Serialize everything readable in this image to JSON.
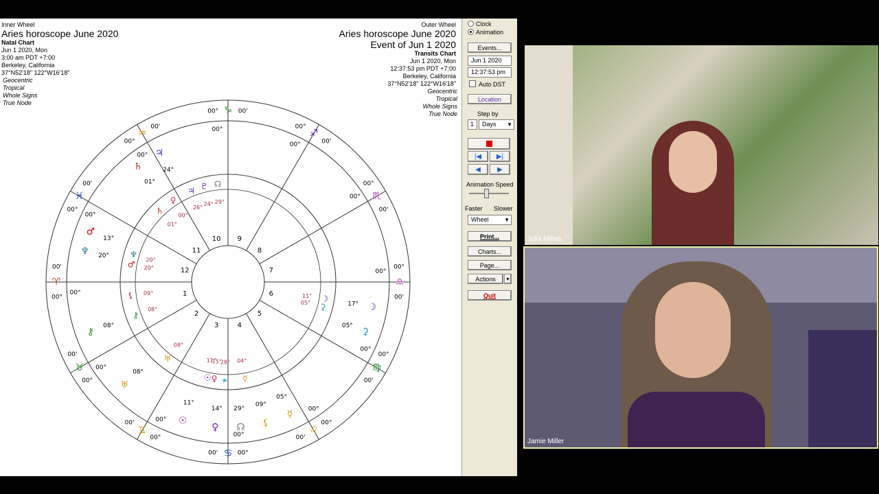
{
  "inner_header": {
    "label": "Inner Wheel",
    "title": "Aries horoscope June 2020",
    "chart_type": "Natal Chart",
    "date": "Jun 1 2020, Mon",
    "time": "3:00 am  PDT +7:00",
    "place": "Berkeley, California",
    "coords": "37°N52'18\" 122°W16'18\"",
    "options": [
      "Geocentric",
      "Tropical",
      "Whole Signs",
      "True Node"
    ]
  },
  "outer_header": {
    "label": "Outer Wheel",
    "title": "Aries horoscope June 2020",
    "event": "Event of Jun 1 2020",
    "chart_type": "Transits Chart",
    "date": "Jun 1 2020, Mon",
    "time": "12:37:53 pm  PDT +7:00",
    "place": "Berkeley, California",
    "coords": "37°N52'18\" 122°W16'18\"",
    "options": [
      "Geocentric",
      "Tropical",
      "Whole Signs",
      "True Node"
    ]
  },
  "wheel": {
    "house_numbers": [
      "1",
      "2",
      "3",
      "4",
      "5",
      "6",
      "7",
      "8",
      "9",
      "10",
      "11",
      "12"
    ],
    "cusp_degree": "00°",
    "cusp_minute": "00'",
    "signs": [
      "♈",
      "♉",
      "♊",
      "♋",
      "♌",
      "♍",
      "♎",
      "♏",
      "♐",
      "♑",
      "♒",
      "♓"
    ],
    "sign_colors": [
      "#c0392b",
      "#2e8b2e",
      "#d4a017",
      "#1f3fbf",
      "#d4a017",
      "#2e8b2e",
      "#b43ab4",
      "#b43ab4",
      "#6a2fb0",
      "#2e8b2e",
      "#d4a017",
      "#1f3fbf"
    ],
    "natal_labels": [
      {
        "glyph": "♃",
        "deg": "26°"
      },
      {
        "glyph": "♀",
        "deg": "00°"
      },
      {
        "glyph": "♄",
        "deg": "01°"
      },
      {
        "glyph": "♇",
        "deg": "24°"
      },
      {
        "glyph": "☊",
        "deg": "29°"
      },
      {
        "glyph": "♂",
        "deg": "20°"
      },
      {
        "glyph": "♆",
        "deg": "20°"
      },
      {
        "glyph": "⚷",
        "deg": "08°"
      },
      {
        "glyph": "♅",
        "deg": "08°"
      },
      {
        "glyph": "☉",
        "deg": "11°"
      },
      {
        "glyph": "♀",
        "deg": "15°"
      },
      {
        "glyph": "⚹",
        "deg": "28°"
      },
      {
        "glyph": "☿",
        "deg": "04°"
      },
      {
        "glyph": "☽",
        "deg": "11°"
      },
      {
        "glyph": "⚳",
        "deg": "05°"
      },
      {
        "glyph": "⚸",
        "deg": "09°"
      }
    ],
    "transit_labels": [
      {
        "glyph": "♃",
        "deg": "24°"
      },
      {
        "glyph": "♄",
        "deg": "01°"
      },
      {
        "glyph": "♂",
        "deg": "13°"
      },
      {
        "glyph": "♆",
        "deg": "20°"
      },
      {
        "glyph": "⚷",
        "deg": "08°"
      },
      {
        "glyph": "♅",
        "deg": "08°"
      },
      {
        "glyph": "☉",
        "deg": "11°"
      },
      {
        "glyph": "♀",
        "deg": "14°"
      },
      {
        "glyph": "☊",
        "deg": "29°"
      },
      {
        "glyph": "☽",
        "deg": "17°"
      },
      {
        "glyph": "⚳",
        "deg": "05°"
      },
      {
        "glyph": "☿",
        "deg": "05°"
      },
      {
        "glyph": "⚸",
        "deg": "09°"
      }
    ]
  },
  "panel": {
    "radio_clock": "Clock",
    "radio_animation": "Animation",
    "events_btn": "Events...",
    "date_value": "Jun 1 2020",
    "time_value": "12:37:53 pm",
    "auto_dst": "Auto DST",
    "location_btn": "Location",
    "step_by": "Step by",
    "step_value": "1",
    "step_unit": "Days",
    "anim_speed": "Animation Speed",
    "faster": "Faster",
    "slower": "Slower",
    "wheel_select": "Wheel",
    "print_btn": "Print...",
    "charts_btn": "Charts...",
    "page_btn": "Page...",
    "actions_btn": "Actions",
    "quit_btn": "Quit"
  },
  "videos": {
    "top_name": "Julia Mihas",
    "bottom_name": "Jamie Miller"
  },
  "colors": {
    "accent_active": "#f0f0a0",
    "record": "#e00000",
    "nav_arrow": "#1f5fd0"
  }
}
